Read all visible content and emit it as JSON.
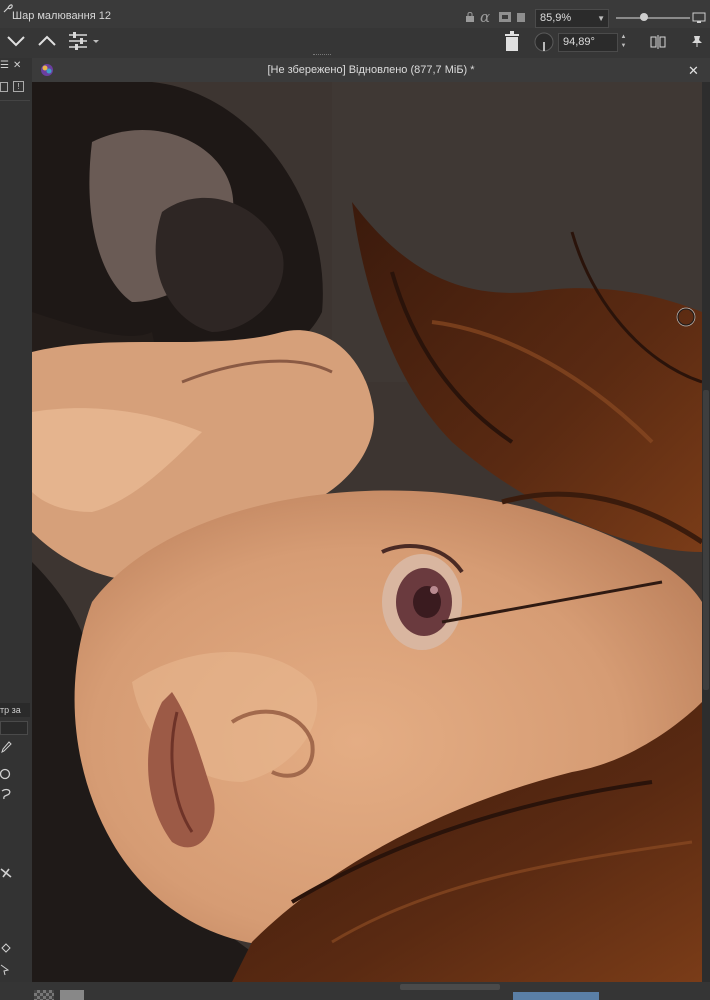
{
  "toolbar": {
    "layer_name": "Шар малювання 12",
    "zoom_value": "85,9%",
    "rotation_value": "94,89°"
  },
  "document": {
    "title": "[Не збережено]  Відновлено (877,7 МіБ) *"
  },
  "left_dock": {
    "filter_field_text": "тр за"
  },
  "icons": {
    "layer_icon": "brush-layer-icon",
    "lock": "lock-icon",
    "alpha": "alpha-lock-icon",
    "wrap": "wrap-icon",
    "down": "chevron-down-icon",
    "up": "chevron-up-icon",
    "settings": "sliders-icon",
    "trash": "trash-icon",
    "dial": "rotation-dial-icon",
    "mirror": "mirror-icon",
    "pin": "pin-icon",
    "close": "close-icon",
    "krita": "krita-logo-icon",
    "monitor": "canvas-only-icon"
  },
  "colors": {
    "accent": "#5a7fa6",
    "canvas_bg": "#3a302b",
    "skin": "#dba57f",
    "hair": "#4a2210"
  }
}
